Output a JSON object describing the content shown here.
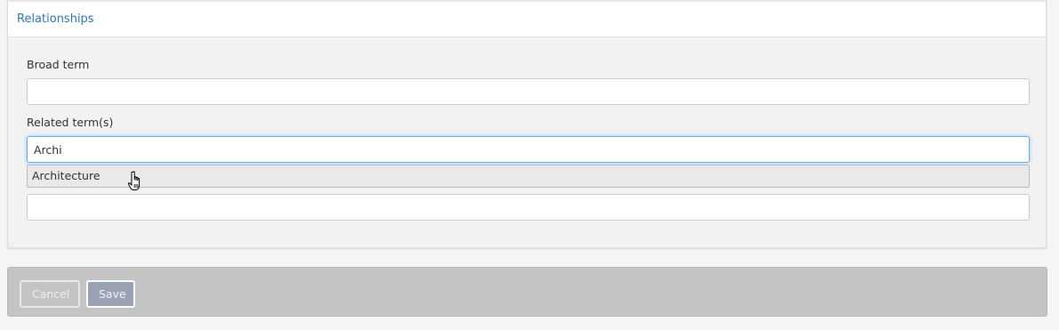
{
  "panel": {
    "title": "Relationships"
  },
  "broad_term": {
    "label": "Broad term",
    "value": ""
  },
  "related_terms": {
    "label": "Related term(s)",
    "inputs": [
      {
        "value": "Archi"
      },
      {
        "value": ""
      }
    ],
    "autocomplete": {
      "suggestions": [
        "Architecture"
      ]
    }
  },
  "actions": {
    "cancel_label": "Cancel",
    "save_label": "Save"
  },
  "colors": {
    "title": "#2a7ab8",
    "focus_border": "#66afe9",
    "action_bar": "#c4c4c4",
    "save_button": "#9aa3b3"
  },
  "icons": {
    "cursor": "hand-pointer-icon"
  }
}
